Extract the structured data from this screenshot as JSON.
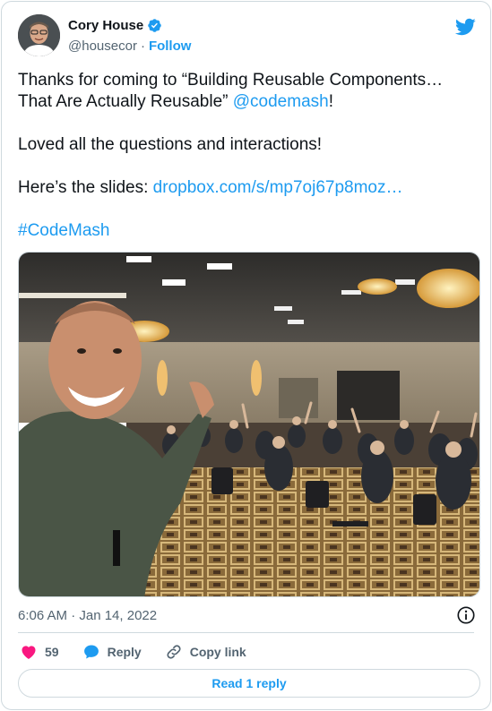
{
  "author": {
    "name": "Cory House",
    "handle": "@housecor",
    "separator": "·",
    "follow_label": "Follow"
  },
  "tweet": {
    "line1_pre": "Thanks for coming to “Building Reusable Components… That Are Actually Reusable” ",
    "mention": "@codemash",
    "line1_post": "!",
    "line2": "Loved all the questions and interactions!",
    "line3_pre": "Here’s the slides: ",
    "slides_link": "dropbox.com/s/mp7oj67p8moz…",
    "hashtag": "#CodeMash"
  },
  "meta": {
    "timestamp": "6:06 AM · Jan 14, 2022"
  },
  "actions": {
    "like_count": "59",
    "reply_label": "Reply",
    "copy_link_label": "Copy link"
  },
  "read_replies_label": "Read 1 reply",
  "colors": {
    "accent": "#1d9bf0",
    "like": "#f91880",
    "text": "#0f1419",
    "muted": "#536471",
    "border": "#cfd9de"
  },
  "icons": [
    "verified-badge-icon",
    "twitter-bird-icon",
    "info-icon",
    "heart-icon",
    "reply-bubble-icon",
    "link-icon"
  ]
}
